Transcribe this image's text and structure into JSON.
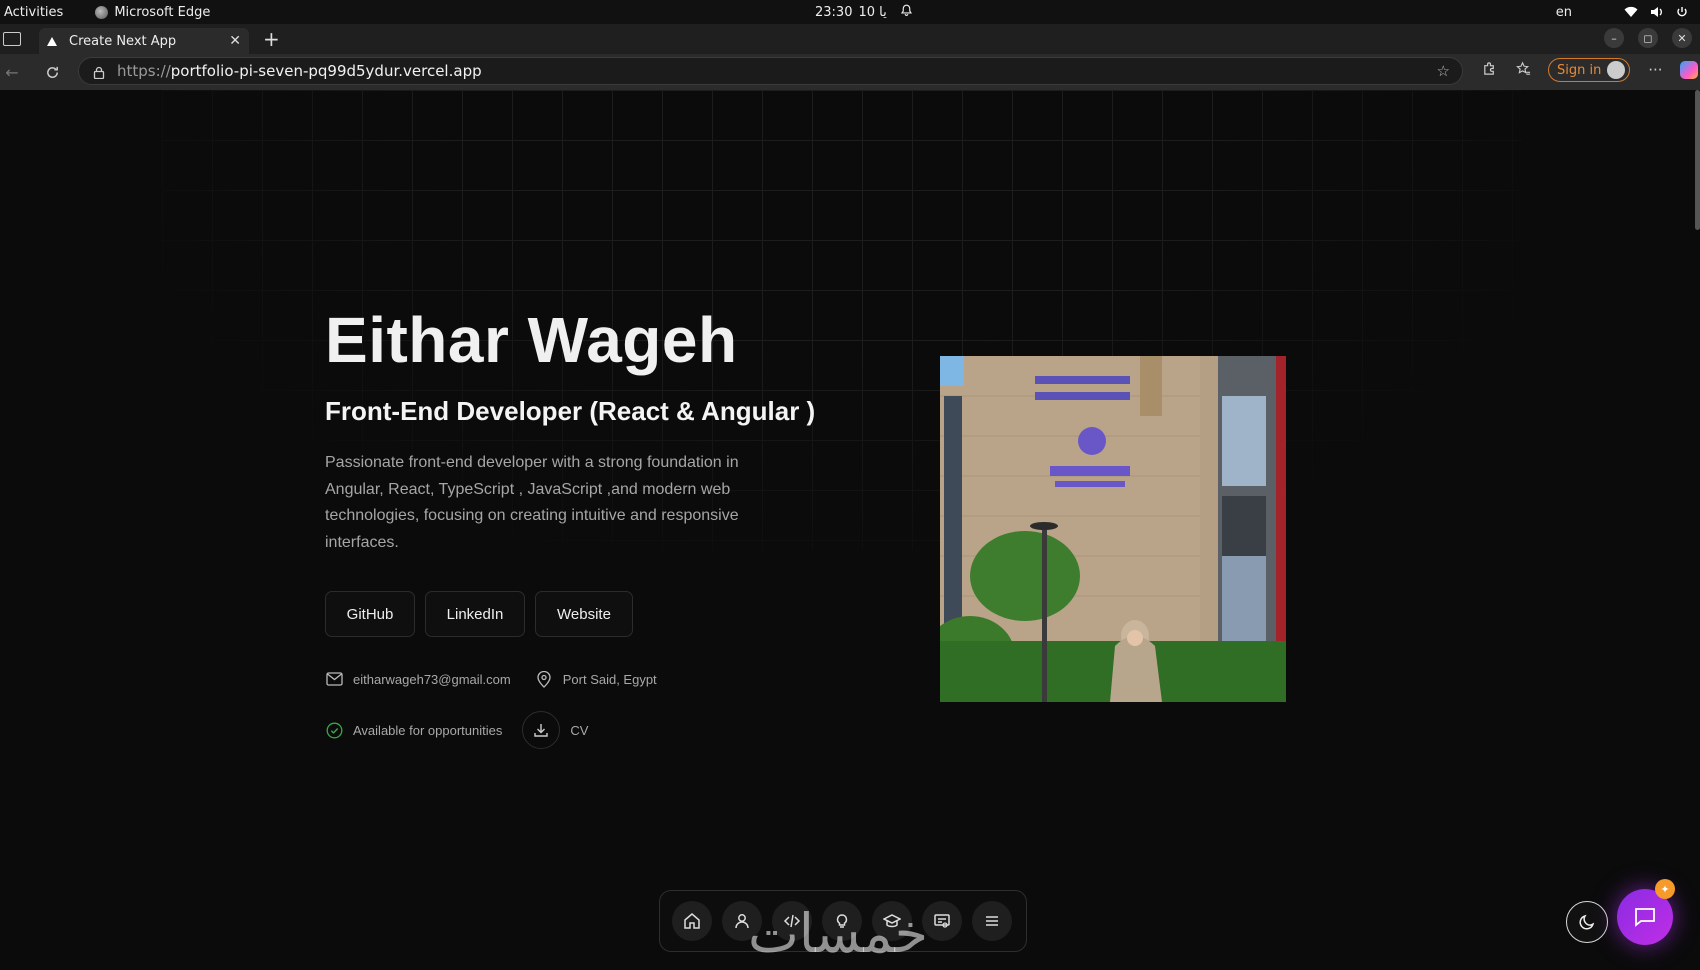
{
  "os_bar": {
    "activities": "Activities",
    "app_name": "Microsoft Edge",
    "time": "23:30",
    "date": "10 يا",
    "lang": "en"
  },
  "browser": {
    "tab_title": "Create Next App",
    "url_scheme": "https://",
    "url_host": "portfolio-pi-seven-pq99d5ydur.vercel.app",
    "sign_in_label": "Sign in"
  },
  "hero": {
    "name": "Eithar Wageh",
    "role": "Front-End Developer (React & Angular )",
    "description": "Passionate front-end developer with a strong foundation in Angular, React, TypeScript , JavaScript ,and modern web technologies, focusing on creating intuitive and responsive interfaces.",
    "buttons": {
      "github": "GitHub",
      "linkedin": "LinkedIn",
      "website": "Website"
    },
    "email": "eitharwageh73@gmail.com",
    "location": "Port Said, Egypt",
    "availability": "Available for opportunities",
    "cv_label": "CV"
  },
  "watermark": "خمسات",
  "colors": {
    "accent_purple": "#9b30e8",
    "badge_orange": "#f59a2b",
    "sign_in_orange": "#e78b38",
    "availability_green": "#3fa54a"
  },
  "dock_icons": [
    "home-icon",
    "user-icon",
    "code-icon",
    "lightbulb-icon",
    "graduation-cap-icon",
    "certificate-icon",
    "menu-icon"
  ]
}
